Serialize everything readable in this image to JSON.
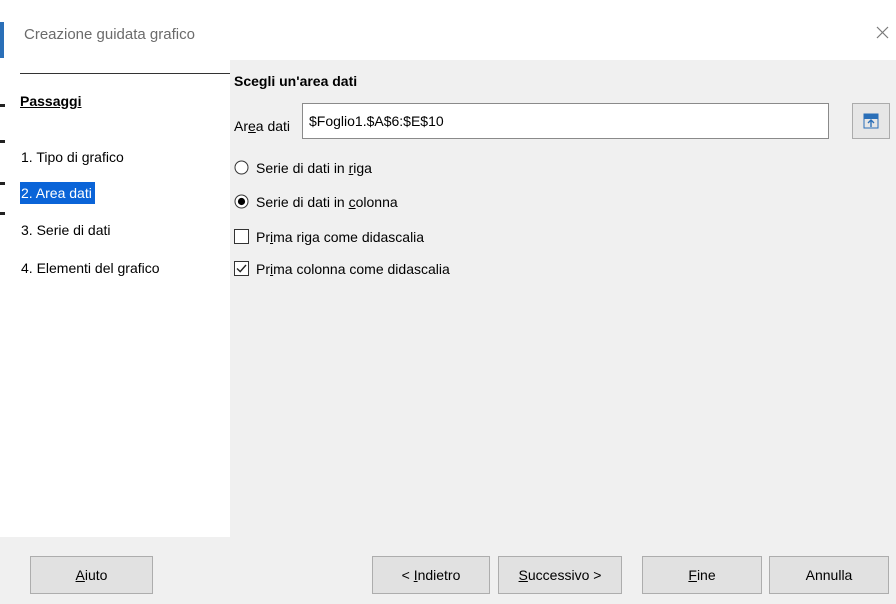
{
  "window": {
    "title": "Creazione guidata grafico"
  },
  "nav": {
    "heading": "Passaggi",
    "steps": [
      {
        "label": "1. Tipo di grafico",
        "selected": false
      },
      {
        "label": "2. Area dati",
        "selected": true
      },
      {
        "label": "3. Serie di dati",
        "selected": false
      },
      {
        "label": "4. Elementi del grafico",
        "selected": false
      }
    ]
  },
  "main": {
    "title": "Scegli un'area dati",
    "area": {
      "label_pre": "Ar",
      "label_mn": "e",
      "label_post": "a dati",
      "value": "$Foglio1.$A$6:$E$10"
    },
    "options": [
      {
        "type": "radio",
        "pre": "Serie di dati in ",
        "mn": "r",
        "post": "iga",
        "checked": false
      },
      {
        "type": "radio",
        "pre": "Serie di dati in ",
        "mn": "c",
        "post": "olonna",
        "checked": true
      },
      {
        "type": "checkbox",
        "pre": "Pr",
        "mn": "i",
        "post": "ma riga come didascalia",
        "checked": false
      },
      {
        "type": "checkbox",
        "pre": "Pr",
        "mn": "i",
        "post": "ma colonna come didascalia",
        "checked": true
      }
    ]
  },
  "footer": {
    "help": {
      "pre": "",
      "mn": "A",
      "post": "iuto"
    },
    "back": {
      "pre": "< ",
      "mn": "I",
      "post": "ndietro"
    },
    "next": {
      "pre": "",
      "mn": "S",
      "post": "uccessivo >"
    },
    "finish": {
      "pre": "",
      "mn": "F",
      "post": "ine"
    },
    "cancel": {
      "pre": "Annulla",
      "mn": "",
      "post": ""
    }
  },
  "colors": {
    "selection": "#0a64d8",
    "panel": "#f0f0f0",
    "accent": "#2a6fb8"
  }
}
